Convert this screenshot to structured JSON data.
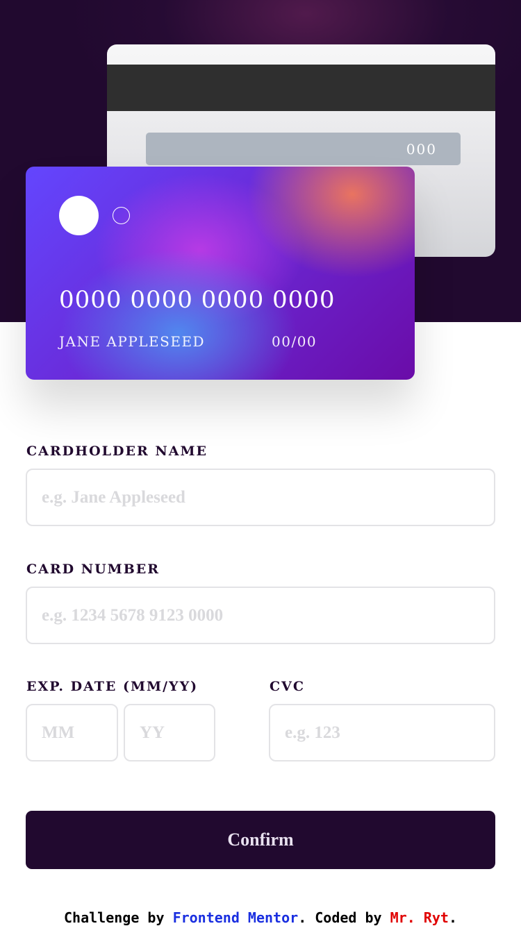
{
  "card_back": {
    "cvc": "000"
  },
  "card_front": {
    "number": "0000 0000 0000 0000",
    "name": "JANE APPLESEED",
    "expiry": "00/00"
  },
  "form": {
    "name_label": "CARDHOLDER NAME",
    "name_placeholder": "e.g. Jane Appleseed",
    "number_label": "CARD NUMBER",
    "number_placeholder": "e.g. 1234 5678 9123 0000",
    "exp_label": "EXP. DATE (MM/YY)",
    "month_placeholder": "MM",
    "year_placeholder": "YY",
    "cvc_label": "CVC",
    "cvc_placeholder": "e.g. 123",
    "confirm_label": "Confirm"
  },
  "footer": {
    "challenge_text": "Challenge by ",
    "frontend_mentor": "Frontend Mentor",
    "coded_text": ". Coded by ",
    "author": "Mr. Ryt",
    "end": "."
  },
  "colors": {
    "dark_purple": "#21092f",
    "input_border": "#e3e3e6",
    "link_blue": "#1a2fe0",
    "author_red": "#e00000"
  }
}
